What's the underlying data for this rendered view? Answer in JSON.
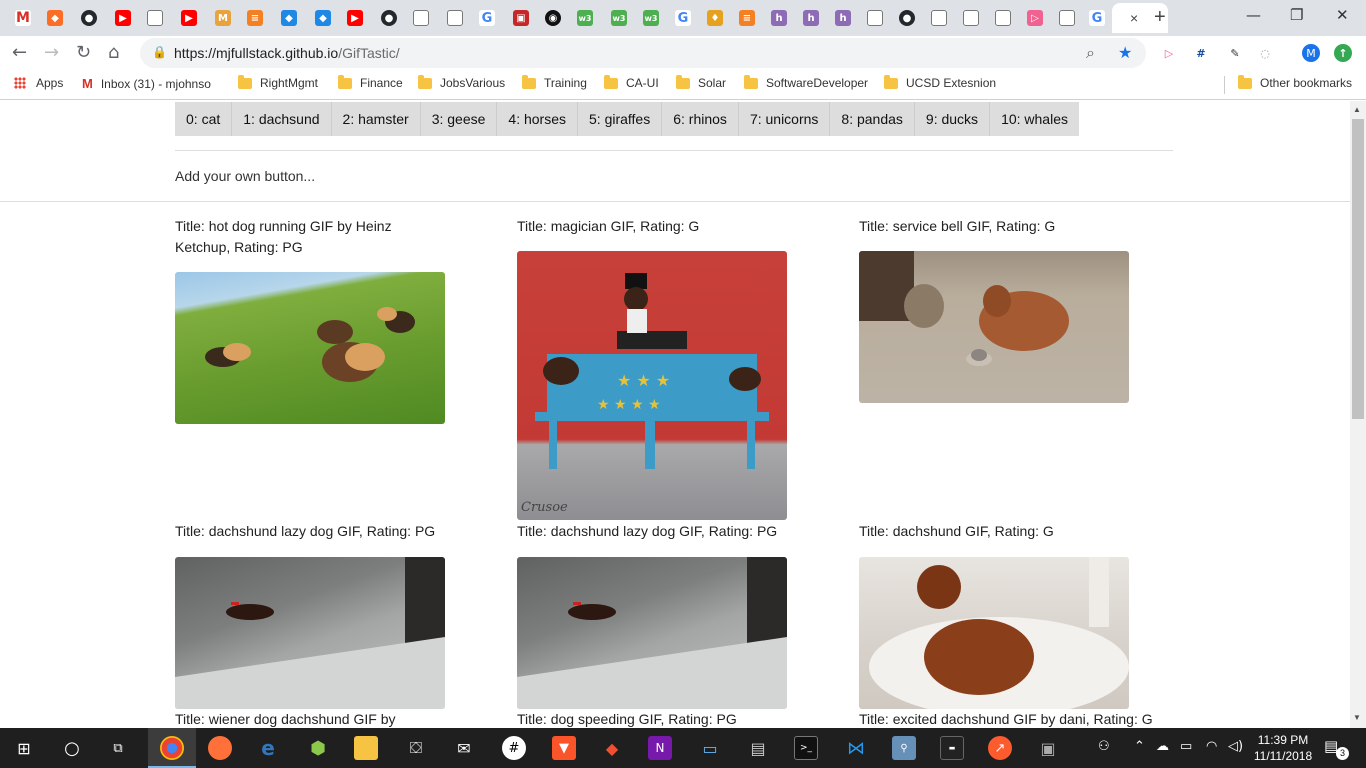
{
  "browser": {
    "url_host": "https://mjfullstack.github.io",
    "url_path": "/GifTastic/",
    "tab_close": "×",
    "new_tab": "+",
    "bookmarks": [
      {
        "label": "Apps",
        "icon": "apps-grid-icon"
      },
      {
        "label": "Inbox (31) - mjohnso",
        "icon": "gmail-icon"
      },
      {
        "label": "RightMgmt",
        "icon": "folder-icon"
      },
      {
        "label": "Finance",
        "icon": "folder-icon"
      },
      {
        "label": "JobsVarious",
        "icon": "folder-icon"
      },
      {
        "label": "Training",
        "icon": "folder-icon"
      },
      {
        "label": "CA-UI",
        "icon": "folder-icon"
      },
      {
        "label": "Solar",
        "icon": "folder-icon"
      },
      {
        "label": "SoftwareDeveloper",
        "icon": "folder-icon"
      },
      {
        "label": "UCSD Extesnion",
        "icon": "folder-icon"
      },
      {
        "label": "Other bookmarks",
        "icon": "folder-icon"
      }
    ],
    "profile_initial": "M"
  },
  "page": {
    "buttons": [
      "0: cat",
      "1: dachsund",
      "2: hamster",
      "3: geese",
      "4: horses",
      "5: giraffes",
      "6: rhinos",
      "7: unicorns",
      "8: pandas",
      "9: ducks",
      "10: whales"
    ],
    "add_placeholder": "Add your own button...",
    "gifs": [
      {
        "title": "Title: hot dog running GIF by Heinz Ketchup,  Rating: PG"
      },
      {
        "title": "Title: magician GIF,  Rating: G",
        "watermark": "Crusoe"
      },
      {
        "title": "Title: service bell GIF,  Rating: G"
      },
      {
        "title": "Title: dachshund lazy dog GIF,  Rating: PG"
      },
      {
        "title": "Title: dachshund lazy dog GIF,  Rating: PG"
      },
      {
        "title": "Title: dachshund GIF,  Rating: G"
      },
      {
        "title": "Title: wiener dog dachshund GIF by"
      },
      {
        "title": "Title: dog speeding GIF,  Rating: PG"
      },
      {
        "title": "Title: excited dachshund GIF by dani,  Rating: G"
      }
    ]
  },
  "taskbar": {
    "time": "11:39 PM",
    "date": "11/11/2018",
    "notification_count": "3"
  }
}
